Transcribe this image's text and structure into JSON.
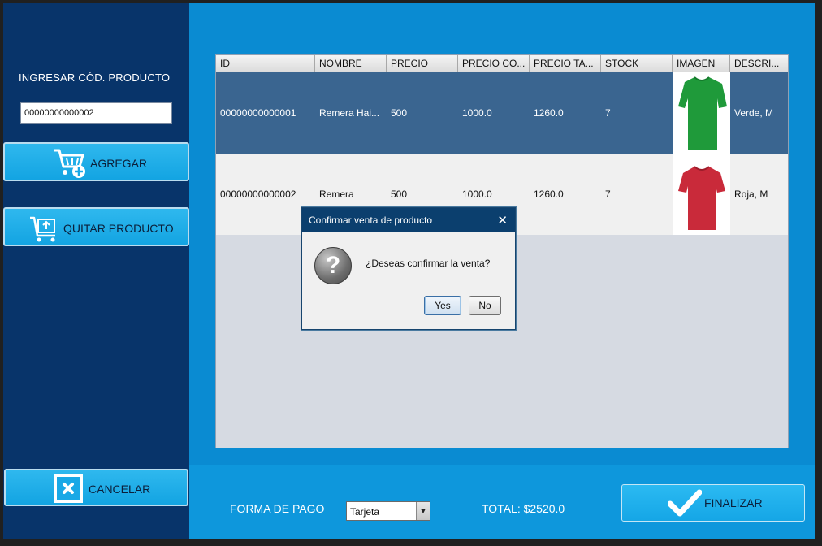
{
  "left_panel": {
    "product_code_label": "INGRESAR CÓD. PRODUCTO",
    "product_code_value": "00000000000002",
    "add_label": "AGREGAR",
    "remove_label": "QUITAR PRODUCTO",
    "cancel_label": "CANCELAR"
  },
  "table": {
    "columns": [
      "ID",
      "NOMBRE",
      "PRECIO",
      "PRECIO CO...",
      "PRECIO TA...",
      "STOCK",
      "IMAGEN",
      "DESCRI..."
    ],
    "rows": [
      {
        "id": "00000000000001",
        "nombre": "Remera Hai...",
        "precio": "500",
        "precio_co": "1000.0",
        "precio_ta": "1260.0",
        "stock": "7",
        "image": "green-tshirt",
        "descripcion": "Verde, M",
        "selected": true
      },
      {
        "id": "00000000000002",
        "nombre": "Remera",
        "precio": "500",
        "precio_co": "1000.0",
        "precio_ta": "1260.0",
        "stock": "7",
        "image": "red-tshirt",
        "descripcion": "Roja, M",
        "selected": false
      }
    ]
  },
  "footer": {
    "payment_label": "FORMA DE PAGO",
    "payment_value": "Tarjeta",
    "total_label": "TOTAL: $2520.0",
    "finish_label": "FINALIZAR"
  },
  "dialog": {
    "title": "Confirmar venta de producto",
    "close_glyph": "✕",
    "icon_glyph": "?",
    "message": "¿Deseas confirmar la venta?",
    "yes_label": "Yes",
    "no_label": "No"
  },
  "colors": {
    "left_panel": "#08346a",
    "right_panel": "#0a8bd2",
    "button": "#1aa8e6",
    "selected_row": "#3a6590",
    "dialog_title": "#0b3f6e"
  }
}
